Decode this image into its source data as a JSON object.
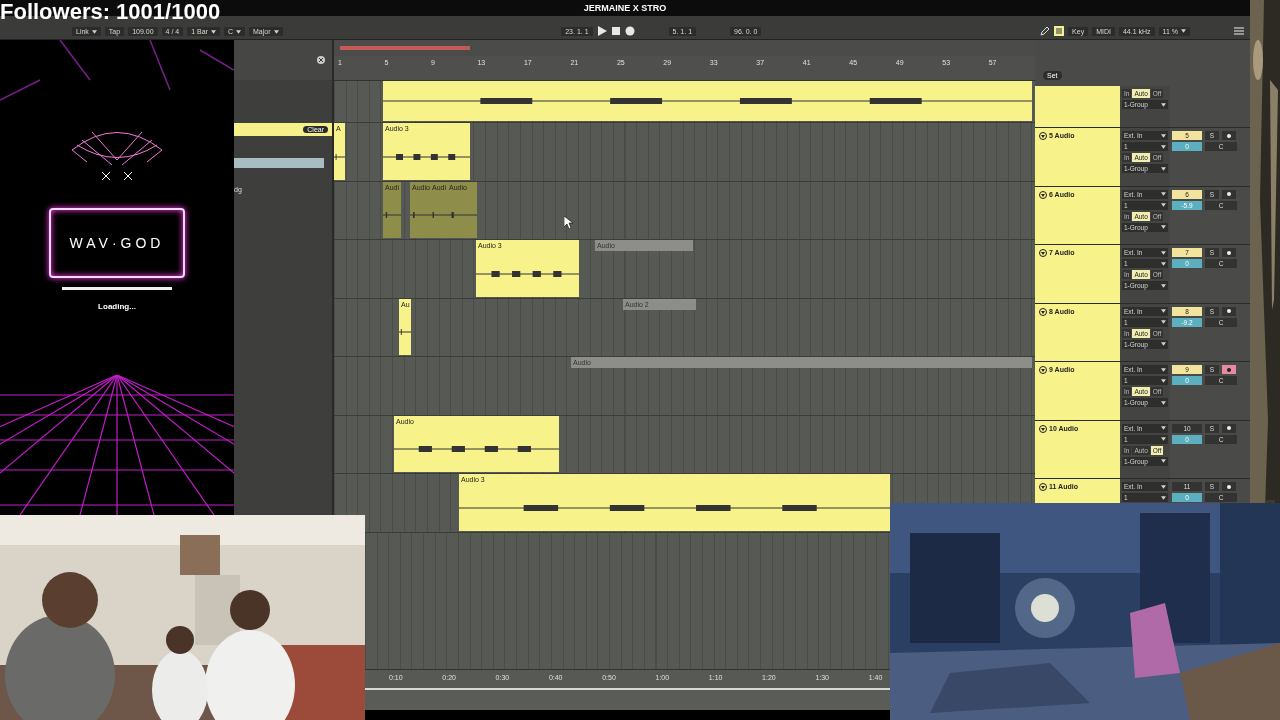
{
  "stream_overlay": {
    "followers": "Followers: 1001/1000",
    "logo": "WAV·GOD",
    "status": "Loading...",
    "loading": {
      "level": 1
    }
  },
  "window": {
    "title": "JERMAINE X STRO"
  },
  "toolbar": {
    "link": "Link",
    "tap": "Tap",
    "tempo": "109.00",
    "meter": "4 / 4",
    "quantize": "1 Bar",
    "key": "C",
    "scale": "Major",
    "position": "23. 1. 1",
    "loop_start": "5. 1. 1",
    "loop_length": "96. 0. 0",
    "key_map": "Key",
    "midi_map": "MIDI",
    "sample_rate": "44.1 kHz",
    "cpu": "11 %"
  },
  "browser": {
    "clear": "Clear",
    "item": "dg"
  },
  "arrangement": {
    "set": "Set",
    "bars": [
      "1",
      "5",
      "9",
      "13",
      "17",
      "21",
      "25",
      "29",
      "33",
      "37",
      "41",
      "45",
      "49",
      "53",
      "57"
    ],
    "lanes": [
      {
        "clips": [
          {
            "kind": "audio"
          }
        ]
      },
      {
        "clips": [
          {
            "kind": "audio",
            "name": "A"
          },
          {
            "kind": "audio",
            "name": "Audio 3"
          }
        ]
      },
      {
        "clips": [
          {
            "kind": "deactivated",
            "name": "Audi"
          },
          {
            "kind": "deactivated",
            "name": "Audio"
          },
          {
            "kind": "deactivated",
            "name": "Audi"
          },
          {
            "kind": "deactivated",
            "name": "Audio"
          }
        ]
      },
      {
        "clips": [
          {
            "kind": "audio",
            "name": "Audio 3"
          },
          {
            "kind": "muted",
            "name": "Audio"
          }
        ]
      },
      {
        "clips": [
          {
            "kind": "audio",
            "name": "Au"
          },
          {
            "kind": "muted",
            "name": "Audio 2"
          }
        ]
      },
      {
        "clips": [
          {
            "kind": "muted",
            "name": "Audio"
          }
        ]
      },
      {
        "clips": [
          {
            "kind": "audio",
            "name": "Audio"
          }
        ]
      },
      {
        "clips": [
          {
            "kind": "audio",
            "name": "Audio 3"
          }
        ]
      }
    ],
    "time_ruler": [
      "0:10",
      "0:20",
      "0:30",
      "0:40",
      "0:50",
      "1:00",
      "1:10",
      "1:20",
      "1:30",
      "1:40"
    ]
  },
  "top_track": {
    "monitor": [
      {
        "label": "In",
        "selected": false
      },
      {
        "label": "Auto",
        "selected": true
      },
      {
        "label": "Off",
        "selected": false
      }
    ],
    "group": "1-Group"
  },
  "tracks": [
    {
      "name": "5 Audio",
      "input": "Ext. In",
      "channel": "1",
      "monitor": [
        {
          "label": "In",
          "selected": false
        },
        {
          "label": "Auto",
          "selected": true
        },
        {
          "label": "Off",
          "selected": false
        }
      ],
      "group": "1-Group",
      "number": "5",
      "selected": true,
      "solo": "S",
      "armed": false,
      "volume": "0",
      "pan": "C"
    },
    {
      "name": "6 Audio",
      "input": "Ext. In",
      "channel": "1",
      "monitor": [
        {
          "label": "In",
          "selected": false
        },
        {
          "label": "Auto",
          "selected": true
        },
        {
          "label": "Off",
          "selected": false
        }
      ],
      "group": "1-Group",
      "number": "6",
      "selected": true,
      "solo": "S",
      "armed": false,
      "volume": "-5.9",
      "pan": "C"
    },
    {
      "name": "7 Audio",
      "input": "Ext. In",
      "channel": "1",
      "monitor": [
        {
          "label": "In",
          "selected": false
        },
        {
          "label": "Auto",
          "selected": true
        },
        {
          "label": "Off",
          "selected": false
        }
      ],
      "group": "1-Group",
      "number": "7",
      "selected": true,
      "solo": "S",
      "armed": false,
      "volume": "0",
      "pan": "C"
    },
    {
      "name": "8 Audio",
      "input": "Ext. In",
      "channel": "1",
      "monitor": [
        {
          "label": "In",
          "selected": false
        },
        {
          "label": "Auto",
          "selected": true
        },
        {
          "label": "Off",
          "selected": false
        }
      ],
      "group": "1-Group",
      "number": "8",
      "selected": true,
      "solo": "S",
      "armed": false,
      "volume": "-9.2",
      "pan": "C"
    },
    {
      "name": "9 Audio",
      "input": "Ext. In",
      "channel": "1",
      "monitor": [
        {
          "label": "In",
          "selected": false
        },
        {
          "label": "Auto",
          "selected": true
        },
        {
          "label": "Off",
          "selected": false
        }
      ],
      "group": "1-Group",
      "number": "9",
      "selected": true,
      "solo": "S",
      "armed": true,
      "volume": "0",
      "pan": "C"
    },
    {
      "name": "10 Audio",
      "input": "Ext. In",
      "channel": "1",
      "monitor": [
        {
          "label": "In",
          "selected": false
        },
        {
          "label": "Auto",
          "selected": false
        },
        {
          "label": "Off",
          "selected": true
        }
      ],
      "group": "1-Group",
      "number": "10",
      "selected": false,
      "solo": "S",
      "armed": false,
      "volume": "0",
      "pan": "C"
    },
    {
      "name": "11 Audio",
      "input": "Ext. In",
      "channel": "1",
      "number": "11",
      "selected": false,
      "solo": "S",
      "armed": false,
      "volume": "0",
      "pan": "C"
    }
  ]
}
